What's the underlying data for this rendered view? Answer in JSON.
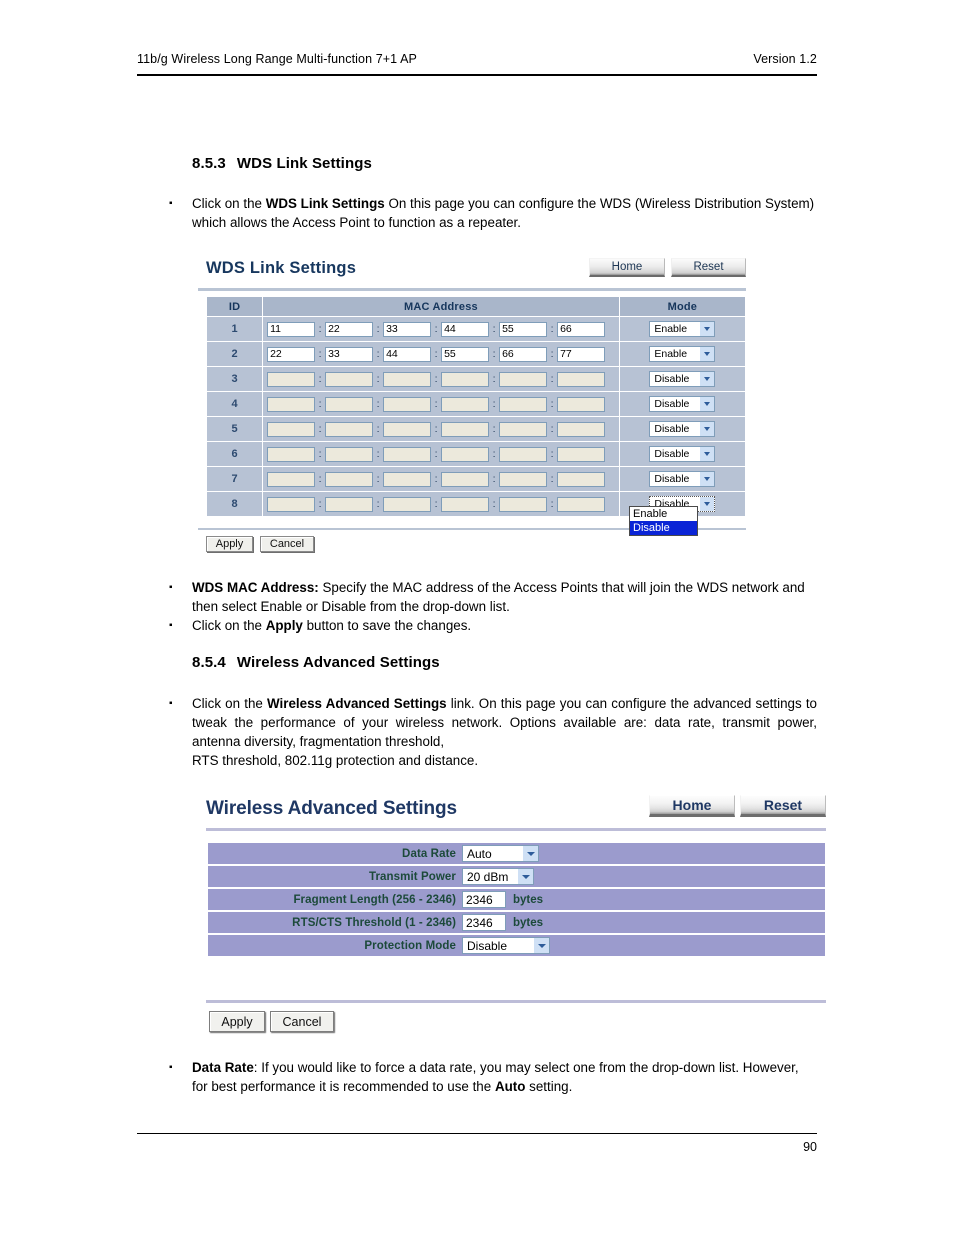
{
  "doc": {
    "header_left": "11b/g Wireless Long Range Multi-function 7+1 AP",
    "header_right": "Version 1.2",
    "page_number": "90"
  },
  "sections": {
    "wds": {
      "number": "8.5.3",
      "title": "WDS Link Settings",
      "intro_a": "Click on the ",
      "intro_b": "WDS Link Settings",
      "intro_c": "  On this page you can configure the WDS (Wireless Distribution System) which allows the Access Point to function as a repeater.",
      "bullet_mac_label": "WDS MAC Address:",
      "bullet_mac_text": " Specify the MAC address of the Access Points that will join the WDS network and then select Enable or Disable from the drop-down list.",
      "bullet_apply_a": "Click on the ",
      "bullet_apply_b": "Apply",
      "bullet_apply_c": " button to save the changes."
    },
    "advanced": {
      "number": "8.5.4",
      "title": "Wireless Advanced Settings",
      "intro_a": "Click on the ",
      "intro_b": "Wireless Advanced Settings",
      "intro_c": " link. On this page you can configure the advanced settings to tweak the performance of your wireless network. Options available are: data rate, transmit power, antenna diversity, fragmentation threshold,",
      "intro_d": "RTS threshold, 802.11g protection and distance.",
      "bullet_rate_label": "Data Rate",
      "bullet_rate_text_a": ": If you would like to force a data rate, you may select one from the drop-down list. However, for best performance it is recommended to use the ",
      "bullet_rate_bold": "Auto",
      "bullet_rate_text_b": " setting."
    }
  },
  "wds_panel": {
    "title": "WDS Link Settings",
    "home_label": "Home",
    "reset_label": "Reset",
    "columns": [
      "ID",
      "MAC Address",
      "Mode"
    ],
    "separator": ":",
    "rows": [
      {
        "id": "1",
        "mac": [
          "11",
          "22",
          "33",
          "44",
          "55",
          "66"
        ],
        "mode": "Enable"
      },
      {
        "id": "2",
        "mac": [
          "22",
          "33",
          "44",
          "55",
          "66",
          "77"
        ],
        "mode": "Enable"
      },
      {
        "id": "3",
        "mac": [
          "",
          "",
          "",
          "",
          "",
          ""
        ],
        "mode": "Disable"
      },
      {
        "id": "4",
        "mac": [
          "",
          "",
          "",
          "",
          "",
          ""
        ],
        "mode": "Disable"
      },
      {
        "id": "5",
        "mac": [
          "",
          "",
          "",
          "",
          "",
          ""
        ],
        "mode": "Disable"
      },
      {
        "id": "6",
        "mac": [
          "",
          "",
          "",
          "",
          "",
          ""
        ],
        "mode": "Disable"
      },
      {
        "id": "7",
        "mac": [
          "",
          "",
          "",
          "",
          "",
          ""
        ],
        "mode": "Disable"
      },
      {
        "id": "8",
        "mac": [
          "",
          "",
          "",
          "",
          "",
          ""
        ],
        "mode": "Disable"
      }
    ],
    "open_dropdown": {
      "options": [
        "Enable",
        "Disable"
      ],
      "selected": "Disable"
    },
    "apply_label": "Apply",
    "cancel_label": "Cancel"
  },
  "advanced_panel": {
    "title": "Wireless Advanced Settings",
    "home_label": "Home",
    "reset_label": "Reset",
    "fields": [
      {
        "label": "Data Rate",
        "value": "Auto",
        "kind": "select",
        "unit": ""
      },
      {
        "label": "Transmit Power",
        "value": "20 dBm",
        "kind": "select",
        "unit": ""
      },
      {
        "label": "Fragment Length (256 - 2346)",
        "value": "2346",
        "kind": "text",
        "unit": "bytes"
      },
      {
        "label": "RTS/CTS Threshold (1 - 2346)",
        "value": "2346",
        "kind": "text",
        "unit": "bytes"
      },
      {
        "label": "Protection Mode",
        "value": "Disable",
        "kind": "select",
        "unit": ""
      }
    ],
    "apply_label": "Apply",
    "cancel_label": "Cancel"
  },
  "colors": {
    "panel_title_blue": "#17375e",
    "table_header_blue": "#a9b6ca",
    "table_row_blue": "#b7c2d4",
    "advanced_row_purple": "#9b9bcd",
    "advanced_label_green": "#1c4a3a",
    "dropdown_highlight": "#0a24d6"
  }
}
